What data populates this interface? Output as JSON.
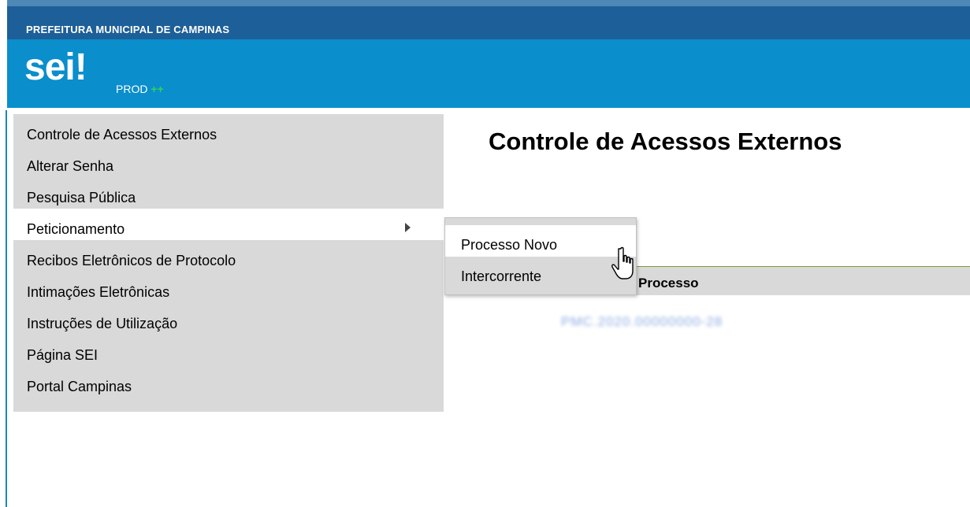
{
  "header": {
    "org_name": "PREFEITURA MUNICIPAL DE CAMPINAS",
    "logo_text": "sei",
    "logo_bang": "!",
    "environment": "PROD",
    "environment_suffix": "++"
  },
  "sidebar": {
    "items": [
      {
        "label": "Controle de Acessos Externos"
      },
      {
        "label": "Alterar Senha"
      },
      {
        "label": "Pesquisa Pública"
      },
      {
        "label": "Peticionamento"
      },
      {
        "label": "Recibos Eletrônicos de Protocolo"
      },
      {
        "label": "Intimações Eletrônicas"
      },
      {
        "label": "Instruções de Utilização"
      },
      {
        "label": "Página SEI"
      },
      {
        "label": "Portal Campinas"
      }
    ]
  },
  "submenu": {
    "items": [
      {
        "label": "Processo Novo"
      },
      {
        "label": "Intercorrente"
      }
    ]
  },
  "main": {
    "title": "Controle de Acessos Externos",
    "table": {
      "columns": [
        "Processo"
      ],
      "rows": [
        {
          "processo": "PMC.2020.00000000-28"
        }
      ]
    }
  },
  "colors": {
    "org_bar": "#1d5f99",
    "brand_bar": "#0a8ecc",
    "menu_bg": "#d9d9d9",
    "accent_green": "#2ed35a",
    "link": "#2a62c8"
  },
  "icons": {
    "submenu_indicator": "triangle-right-icon",
    "cursor": "hand-pointer-icon"
  }
}
